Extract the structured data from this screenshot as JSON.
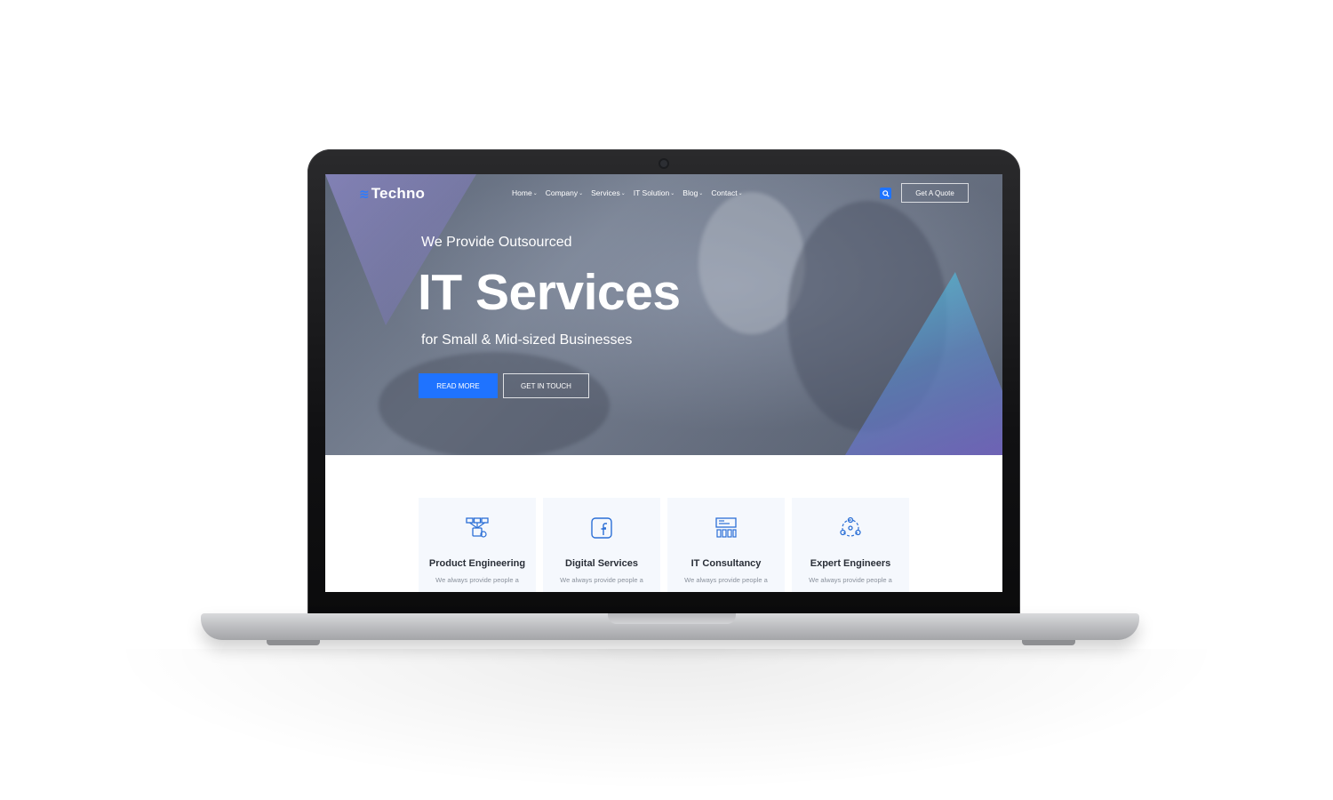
{
  "brand": {
    "name": "Techno",
    "icon": "wind-logo-icon"
  },
  "nav": {
    "items": [
      {
        "label": "Home"
      },
      {
        "label": "Company"
      },
      {
        "label": "Services"
      },
      {
        "label": "IT Solution"
      },
      {
        "label": "Blog"
      },
      {
        "label": "Contact"
      }
    ],
    "quote_label": "Get A Quote"
  },
  "hero": {
    "pre_title": "We Provide Outsourced",
    "title": "IT Services",
    "subtitle": "for Small & Mid-sized Businesses",
    "primary_label": "READ MORE",
    "secondary_label": "GET IN TOUCH"
  },
  "services": [
    {
      "title": "Product Engineering",
      "text": "We always provide people a",
      "icon": "network-icon"
    },
    {
      "title": "Digital Services",
      "text": "We always provide people a",
      "icon": "facebook-icon"
    },
    {
      "title": "IT Consultancy",
      "text": "We always provide people a",
      "icon": "dashboard-icon"
    },
    {
      "title": "Expert Engineers",
      "text": "We always provide people a",
      "icon": "team-icon"
    }
  ],
  "colors": {
    "accent": "#1f73ff",
    "card_bg": "#f5f8fd",
    "title_text": "#2a2f38"
  }
}
